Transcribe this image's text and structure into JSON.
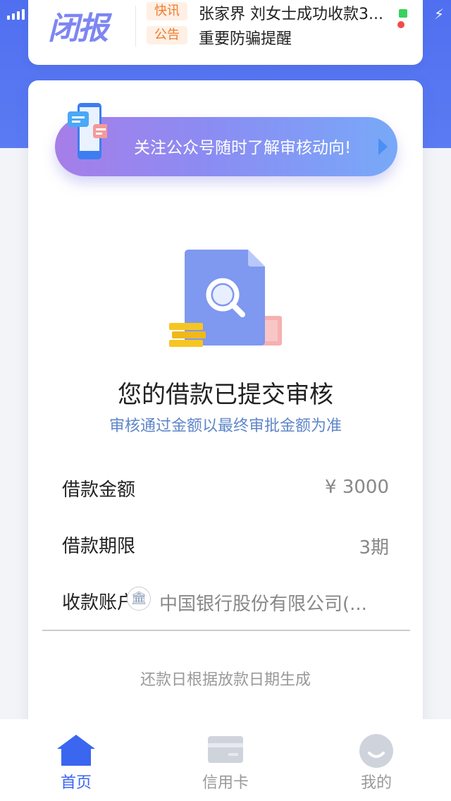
{
  "notice": {
    "brand": "闭报",
    "items": [
      {
        "tag": "快讯",
        "text": "张家界 刘女士成功收款3..."
      },
      {
        "tag": "公告",
        "text": "重要防骗提醒"
      }
    ]
  },
  "banner": {
    "text": "关注公众号随时了解审核动向!"
  },
  "status": {
    "title": "您的借款已提交审核",
    "subtitle": "审核通过金额以最终审批金额为准"
  },
  "details": [
    {
      "label": "借款金额",
      "value": "¥ 3000"
    },
    {
      "label": "借款期限",
      "value": "3期"
    },
    {
      "label": "收款账户",
      "value": "中国银行股份有限公司(..."
    }
  ],
  "footnote": "还款日根据放款日期生成",
  "tabs": [
    {
      "label": "首页",
      "icon": "home-icon",
      "active": true
    },
    {
      "label": "信用卡",
      "icon": "credit-card-icon",
      "active": false
    },
    {
      "label": "我的",
      "icon": "profile-icon",
      "active": false
    }
  ],
  "colors": {
    "primary": "#4f6ff0",
    "tag": "#f07a2a",
    "active_tab": "#3a66f0"
  }
}
